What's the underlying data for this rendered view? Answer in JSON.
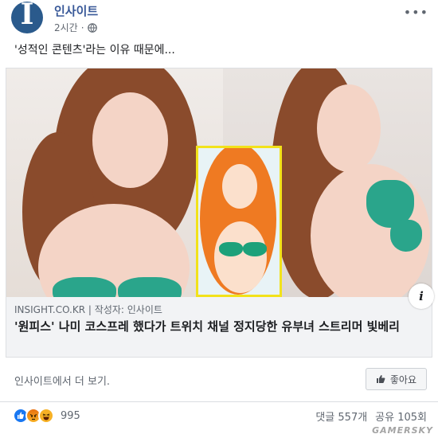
{
  "post": {
    "page_name": "인사이트",
    "time": "2시간",
    "text": "'성적인 콘텐츠'라는 이유 때문에..."
  },
  "link": {
    "domain": "INSIGHT.CO.KR",
    "separator": "|",
    "author": "작성자: 인사이트",
    "title": "'원피스' 나미 코스프레 했다가 트위치 채널 정지당한 유부녀 스트리머 빛베리"
  },
  "footer": {
    "see_more": "인사이트에서 더 보기.",
    "like_label": "좋아요"
  },
  "engagement": {
    "reaction_count": "995",
    "comments": "댓글 557개",
    "shares": "공유 105회"
  },
  "watermark": "GAMERSKY",
  "icons": [
    "globe-icon",
    "more-icon",
    "info-icon",
    "thumbs-up-icon",
    "like-reaction-icon",
    "angry-reaction-icon",
    "haha-reaction-icon"
  ],
  "colors": {
    "page_name": "#385898",
    "like_reaction": "#1877f2",
    "bikini": "#2aa58b",
    "nami_frame": "#f2e21a"
  }
}
